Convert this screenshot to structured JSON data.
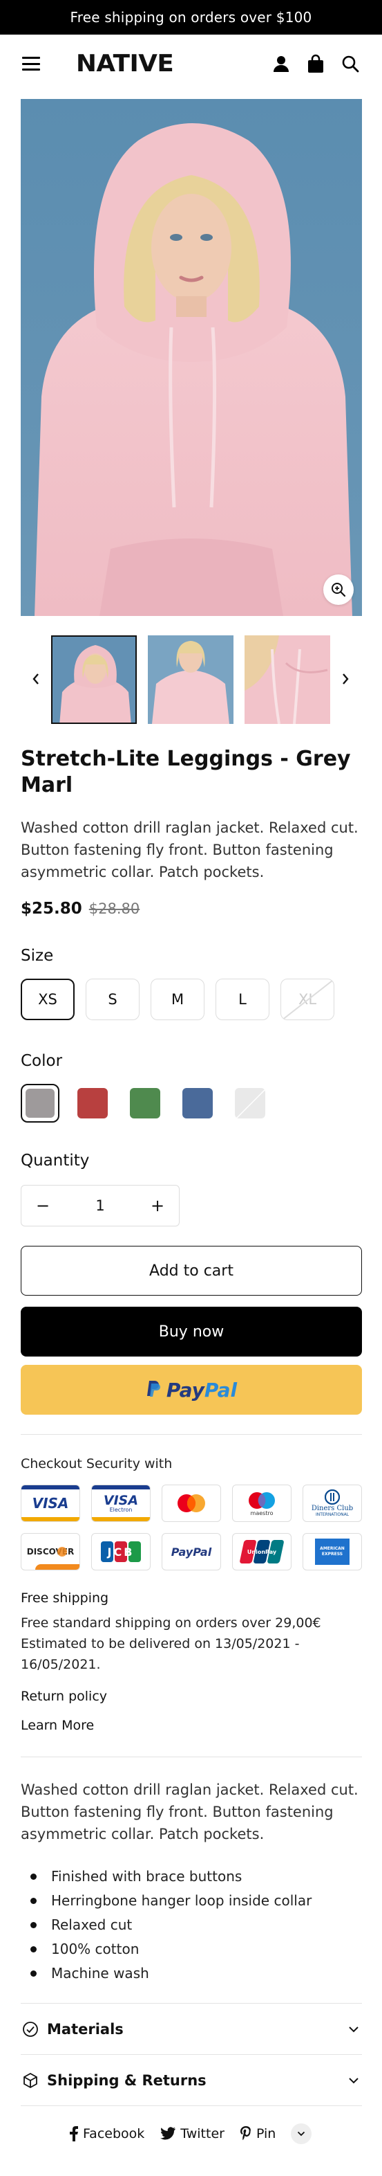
{
  "announcement": "Free shipping on orders over $100",
  "brand": "NATIVE",
  "icons": {
    "menu": "hamburger-menu-icon",
    "account": "user-icon",
    "cart": "shopping-bag-icon",
    "search": "search-icon",
    "zoom": "zoom-in-icon"
  },
  "product": {
    "title": "Stretch-Lite Leggings - Grey Marl",
    "description": "Washed cotton drill raglan jacket. Relaxed cut. Button fastening fly front. Button fastening asymmetric collar. Patch pockets.",
    "price": "$25.80",
    "compare_price": "$28.80"
  },
  "options": {
    "size_label": "Size",
    "sizes": [
      "XS",
      "S",
      "M",
      "L",
      "XL"
    ],
    "selected_size": "XS",
    "disabled_sizes": [
      "XL"
    ],
    "color_label": "Color",
    "colors": [
      {
        "name": "Grey",
        "hex": "#9e9a9b"
      },
      {
        "name": "Red",
        "hex": "#b8403f"
      },
      {
        "name": "Green",
        "hex": "#4f8a4e"
      },
      {
        "name": "Blue",
        "hex": "#4a6a9a"
      },
      {
        "name": "White",
        "hex": "#e9e9e9"
      }
    ],
    "selected_color": "Grey",
    "quantity_label": "Quantity",
    "quantity": "1",
    "minus": "−",
    "plus": "+"
  },
  "buttons": {
    "add_to_cart": "Add to cart",
    "buy_now": "Buy now",
    "paypal_pay": "Pay",
    "paypal_pal": "Pal"
  },
  "checkout": {
    "security_label": "Checkout Security with",
    "cards_row1": [
      "VISA",
      "VISA",
      "mastercard",
      "maestro",
      "Diners Club"
    ],
    "cards_row2": [
      "DISCOVER",
      "JCB",
      "PayPal",
      "UnionPay",
      "AMERICAN EXPRESS"
    ],
    "visa_electron_sub": "Electron",
    "maestro_sub": "maestro",
    "diners_sub": "INTERNATIONAL"
  },
  "shipping": {
    "heading": "Free shipping",
    "line1": "Free standard shipping on orders over 29,00€",
    "line2": "Estimated to be delivered on 13/05/2021 - 16/05/2021."
  },
  "links": {
    "return_policy": "Return policy",
    "learn_more": "Learn More"
  },
  "details": {
    "description": "Washed cotton drill raglan jacket. Relaxed cut. Button fastening fly front. Button fastening asymmetric collar. Patch pockets.",
    "features": [
      "Finished with brace buttons",
      "Herringbone hanger loop inside collar",
      "Relaxed cut",
      "100% cotton",
      "Machine wash"
    ]
  },
  "accordions": {
    "materials": "Materials",
    "shipping_returns": "Shipping & Returns"
  },
  "share": {
    "facebook": "Facebook",
    "twitter": "Twitter",
    "pin": "Pin"
  }
}
